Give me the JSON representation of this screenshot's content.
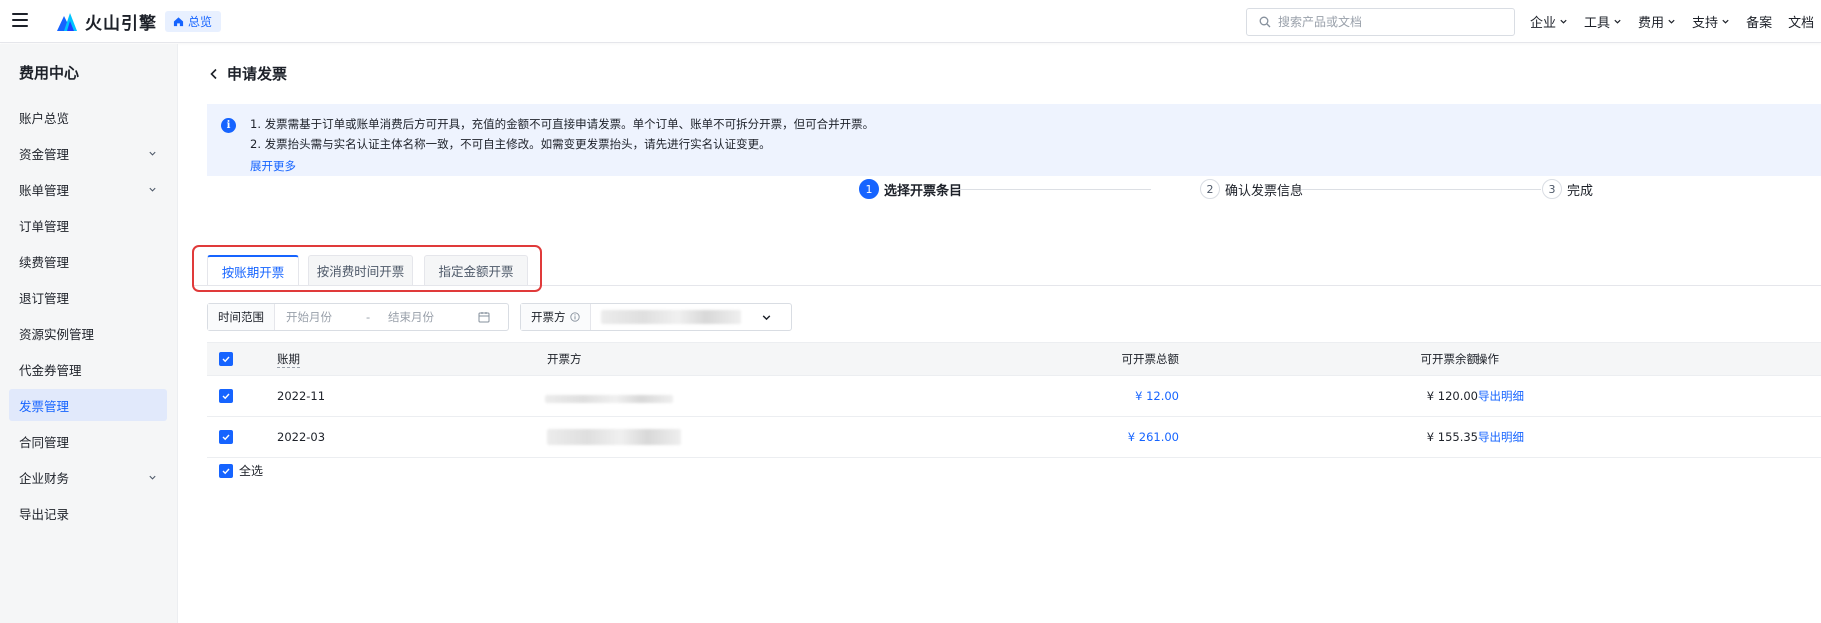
{
  "header": {
    "brand": "火山引擎",
    "crumb": "总览",
    "search_placeholder": "搜索产品或文档",
    "nav": [
      {
        "label": "企业",
        "dropdown": true
      },
      {
        "label": "工具",
        "dropdown": true
      },
      {
        "label": "费用",
        "dropdown": true
      },
      {
        "label": "支持",
        "dropdown": true
      },
      {
        "label": "备案",
        "dropdown": false
      },
      {
        "label": "文档",
        "dropdown": false
      }
    ]
  },
  "sidebar": {
    "title": "费用中心",
    "items": [
      {
        "label": "账户总览",
        "expandable": false,
        "active": false
      },
      {
        "label": "资金管理",
        "expandable": true,
        "active": false
      },
      {
        "label": "账单管理",
        "expandable": true,
        "active": false
      },
      {
        "label": "订单管理",
        "expandable": false,
        "active": false
      },
      {
        "label": "续费管理",
        "expandable": false,
        "active": false
      },
      {
        "label": "退订管理",
        "expandable": false,
        "active": false
      },
      {
        "label": "资源实例管理",
        "expandable": false,
        "active": false
      },
      {
        "label": "代金券管理",
        "expandable": false,
        "active": false
      },
      {
        "label": "发票管理",
        "expandable": false,
        "active": true
      },
      {
        "label": "合同管理",
        "expandable": false,
        "active": false
      },
      {
        "label": "企业财务",
        "expandable": true,
        "active": false
      },
      {
        "label": "导出记录",
        "expandable": false,
        "active": false
      }
    ]
  },
  "page": {
    "title": "申请发票",
    "notice": {
      "line1": "1. 发票需基于订单或账单消费后方可开具，充值的金额不可直接申请发票。单个订单、账单不可拆分开票，但可合并开票。",
      "line2": "2. 发票抬头需与实名认证主体名称一致，不可自主修改。如需变更发票抬头，请先进行实名认证变更。",
      "more": "展开更多"
    },
    "steps": [
      {
        "num": "1",
        "label": "选择开票条目",
        "active": true
      },
      {
        "num": "2",
        "label": "确认发票信息",
        "active": false
      },
      {
        "num": "3",
        "label": "完成",
        "active": false
      }
    ],
    "tabs": [
      {
        "label": "按账期开票",
        "active": true
      },
      {
        "label": "按消费时间开票",
        "active": false
      },
      {
        "label": "指定金额开票",
        "active": false
      }
    ],
    "filters": {
      "range_label": "时间范围",
      "start_placeholder": "开始月份",
      "separator": "-",
      "end_placeholder": "结束月份",
      "issuer_label": "开票方"
    },
    "table": {
      "columns": [
        "账期",
        "开票方",
        "可开票总额",
        "可开票余额",
        "操作"
      ],
      "rows": [
        {
          "period": "2022-11",
          "total": "¥ 12.00",
          "balance": "¥ 120.00",
          "action": "导出明细",
          "checked": true
        },
        {
          "period": "2022-03",
          "total": "¥ 261.00",
          "balance": "¥ 155.35",
          "action": "导出明细",
          "checked": true
        }
      ],
      "select_all": "全选"
    }
  },
  "colors": {
    "accent": "#1664ff",
    "highlight_box": "#e03a3a",
    "notice_bg": "#eef3fe"
  }
}
